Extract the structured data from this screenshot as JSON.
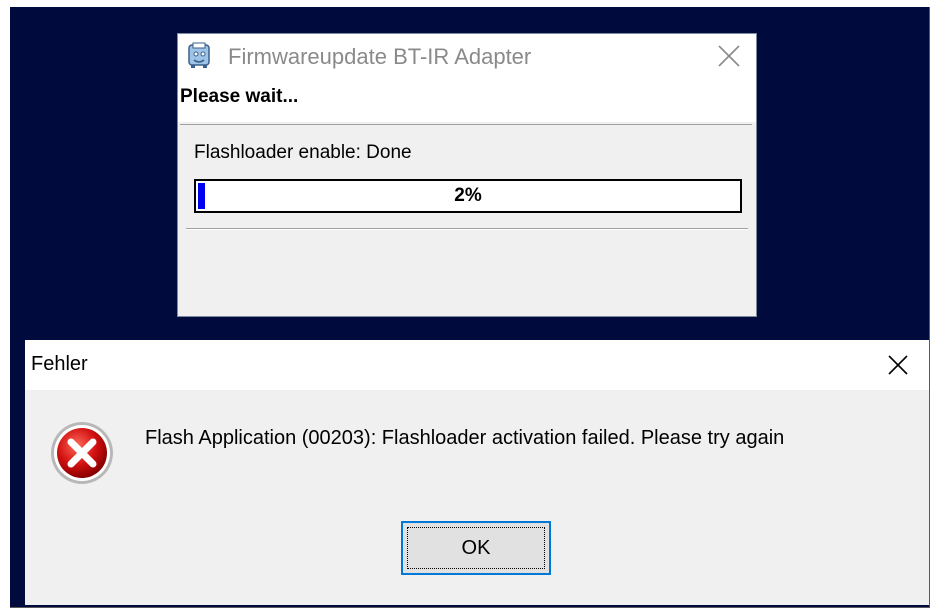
{
  "firmware_window": {
    "title": "Firmwareupdate BT-IR Adapter",
    "icon": "firmware-app-icon",
    "close_icon": "close-icon",
    "heading": "Please wait...",
    "status": "Flashloader enable: Done",
    "progress": {
      "percent": 2,
      "label": "2%",
      "fill_color": "#0000f0"
    }
  },
  "error_dialog": {
    "title": "Fehler",
    "close_icon": "close-icon",
    "icon": "error-icon",
    "message": "Flash Application (00203): Flashloader activation failed. Please try again",
    "ok_label": "OK",
    "accent_color": "#0078d7"
  },
  "colors": {
    "desktop": "#000a3c",
    "dialog_face": "#f0f0f0",
    "error_red": "#d01010"
  }
}
